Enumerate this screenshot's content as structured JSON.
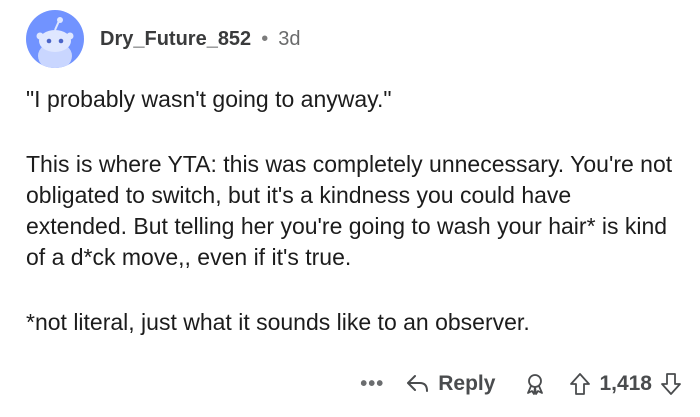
{
  "comment": {
    "username": "Dry_Future_852",
    "separator": "•",
    "age": "3d",
    "paragraphs": [
      "\"I probably wasn't going to anyway.\"",
      "This is where YTA: this was completely unnecessary. You're not obligated to switch, but it's a kindness you could have extended.  But telling her you're going to wash your hair* is kind of a d*ck move,, even if it's true.",
      "*not literal, just what it sounds like to an observer."
    ]
  },
  "actions": {
    "more": "•••",
    "reply": "Reply",
    "score": "1,418"
  },
  "colors": {
    "avatar_bg": "#7193ff",
    "text": "#1c1c1c",
    "meta": "#505254"
  }
}
